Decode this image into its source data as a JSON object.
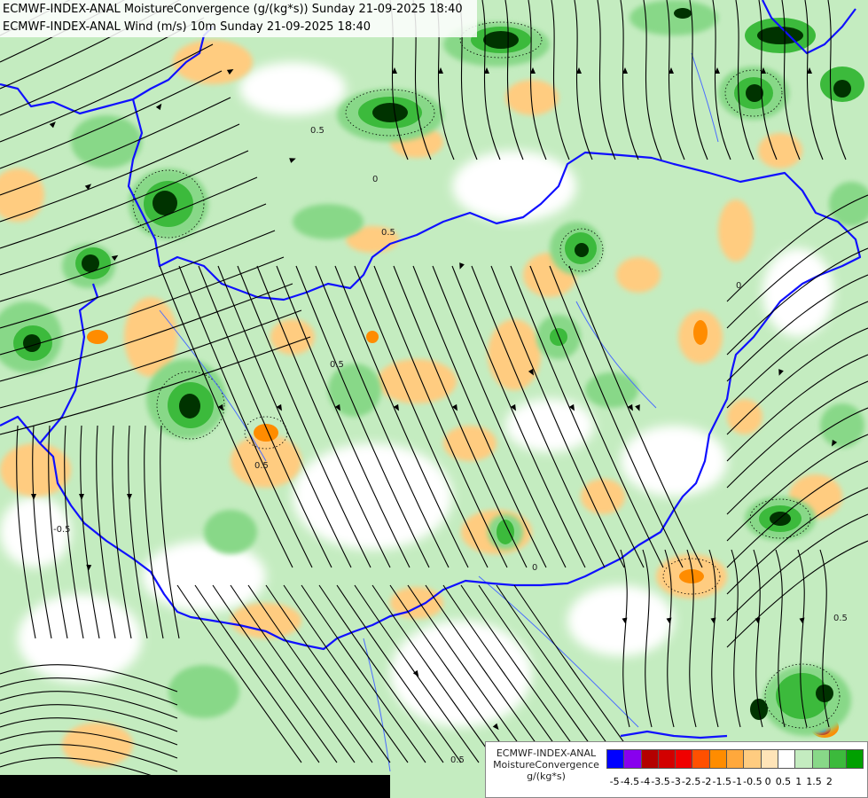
{
  "title": {
    "line1": "ECMWF-INDEX-ANAL MoistureConvergence (g/(kg*s)) Sunday 21-09-2025 18:40",
    "line2": "ECMWF-INDEX-ANAL Wind (m/s) 10m Sunday 21-09-2025 18:40"
  },
  "legend": {
    "model": "ECMWF-INDEX-ANAL",
    "variable": "MoistureConvergence",
    "unit": "g/(kg*s)",
    "ticks": [
      "-5",
      "-4.5",
      "-4",
      "-3.5",
      "-3",
      "-2.5",
      "-2",
      "-1.5",
      "-1",
      "-0.5",
      "0",
      "0.5",
      "1",
      "1.5",
      "2"
    ],
    "colors": [
      "#0000ff",
      "#8800ee",
      "#b40000",
      "#d20000",
      "#f00000",
      "#ff5000",
      "#ff8c00",
      "#ffa83c",
      "#ffcc80",
      "#ffe4b8",
      "#ffffff",
      "#c4ecc0",
      "#88d888",
      "#3cba3c",
      "#00a000"
    ]
  },
  "contour_labels": [
    "0.5",
    "0",
    "0.5",
    "0.5",
    "-0.5",
    "0",
    "0.5",
    "0",
    "0.5",
    "0.5"
  ],
  "colors": {
    "border": "#1010ff",
    "river": "#4a6cff",
    "streamline": "#000000"
  }
}
